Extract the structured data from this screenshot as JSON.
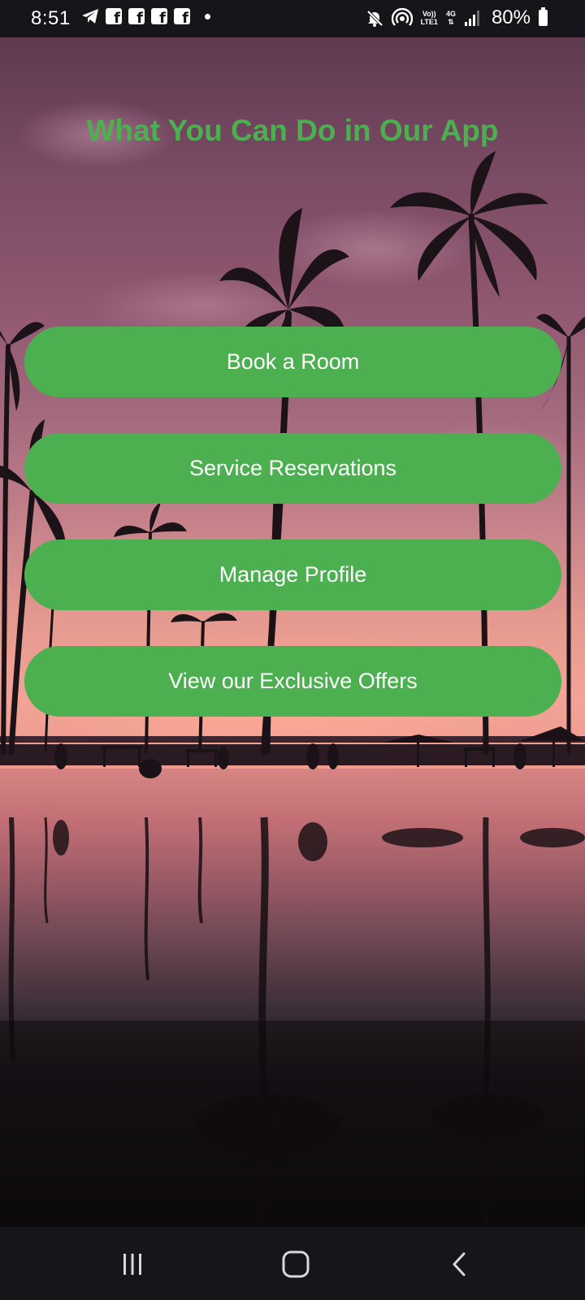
{
  "status_bar": {
    "time": "8:51",
    "battery": "80%",
    "network_top": "Vo))",
    "network_bottom": "LTE1",
    "signal_gen": "4G",
    "icons": [
      "telegram-icon",
      "facebook-icon",
      "facebook-icon",
      "facebook-icon",
      "facebook-icon",
      "notification-dot-icon",
      "mute-icon",
      "hotspot-icon",
      "volte-icon",
      "data-4g-icon",
      "signal-icon",
      "battery-icon"
    ]
  },
  "main": {
    "title": "What You Can Do in Our App",
    "buttons": [
      {
        "label": "Book a Room"
      },
      {
        "label": "Service Reservations"
      },
      {
        "label": "Manage Profile"
      },
      {
        "label": "View our Exclusive Offers"
      }
    ]
  },
  "nav_bar": {
    "icons": [
      "recents-icon",
      "home-icon",
      "back-icon"
    ]
  },
  "colors": {
    "accent": "#4caf50",
    "button_text": "#ffffff",
    "bars": "#16161a"
  }
}
